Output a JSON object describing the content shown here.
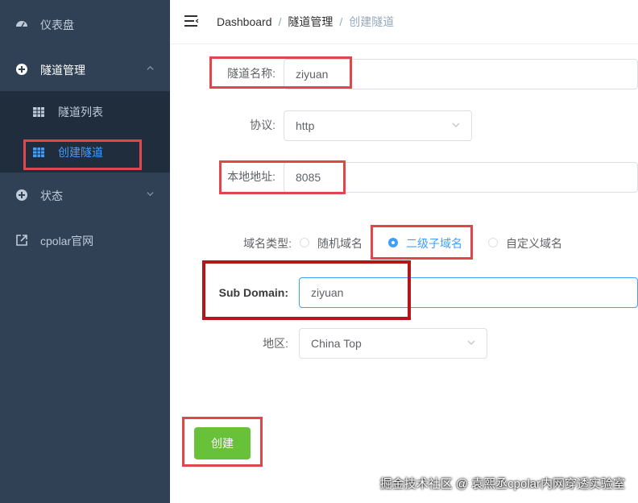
{
  "sidebar": {
    "items": [
      {
        "label": "仪表盘",
        "icon": "dashboard-icon"
      },
      {
        "label": "隧道管理",
        "icon": "plus-circle-icon"
      },
      {
        "label": "状态",
        "icon": "plus-circle-icon"
      },
      {
        "label": "cpolar官网",
        "icon": "external-link-icon"
      }
    ],
    "submenu": [
      {
        "label": "隧道列表",
        "icon": "table-icon"
      },
      {
        "label": "创建隧道",
        "icon": "table-icon",
        "active": true
      }
    ]
  },
  "breadcrumb": [
    "Dashboard",
    "隧道管理",
    "创建隧道"
  ],
  "form": {
    "name": {
      "label": "隧道名称:",
      "value": "ziyuan"
    },
    "protocol": {
      "label": "协议:",
      "value": "http"
    },
    "local_address": {
      "label": "本地地址:",
      "value": "8085"
    },
    "domain_type": {
      "label": "域名类型:",
      "options": [
        "随机域名",
        "二级子域名",
        "自定义域名"
      ],
      "selected": "二级子域名"
    },
    "sub_domain": {
      "label": "Sub Domain:",
      "value": "ziyuan"
    },
    "region": {
      "label": "地区:",
      "value": "China Top"
    },
    "submit_label": "创建"
  },
  "watermark": "掘金技术社区 @ 袁熙丞cpolar内网穿透实验室",
  "colors": {
    "sidebar_bg": "#304156",
    "accent": "#409eff",
    "button": "#67c23a",
    "highlight": "#e0474c"
  }
}
